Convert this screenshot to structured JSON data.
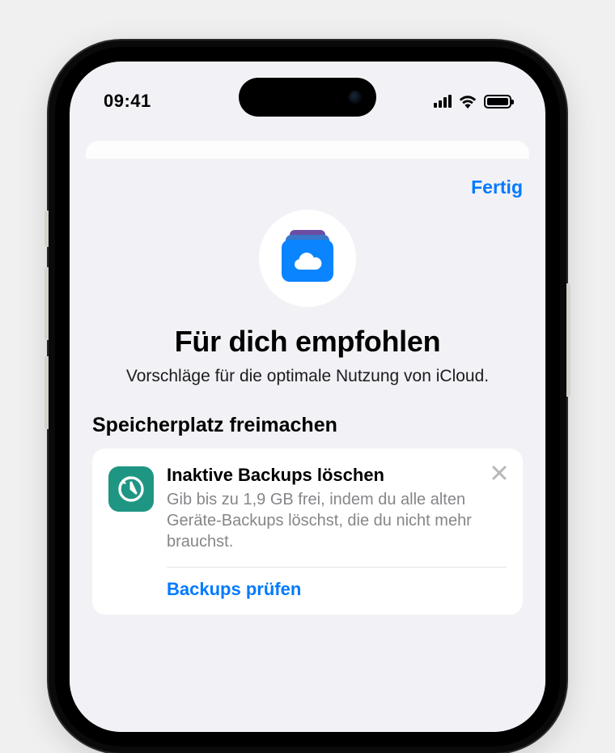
{
  "status": {
    "time": "09:41"
  },
  "sheet": {
    "done_label": "Fertig",
    "title": "Für dich empfohlen",
    "subtitle": "Vorschläge für die optimale Nutzung von iCloud."
  },
  "section": {
    "heading": "Speicherplatz freimachen"
  },
  "recommendation": {
    "icon": "backup-restore-icon",
    "title": "Inaktive Backups löschen",
    "description": "Gib bis zu 1,9 GB frei, indem du alle alten Geräte-Backups löschst, die du nicht mehr brauchst.",
    "action_label": "Backups prüfen"
  }
}
